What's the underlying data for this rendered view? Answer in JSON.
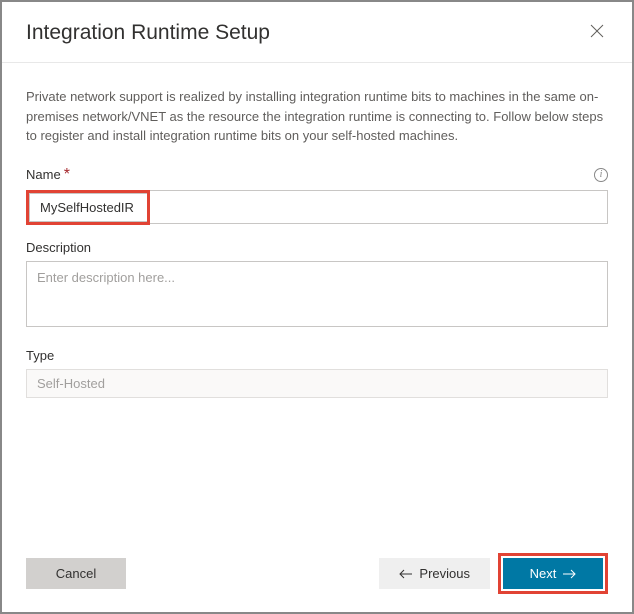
{
  "header": {
    "title": "Integration Runtime Setup"
  },
  "intro_text": "Private network support is realized by installing integration runtime bits to machines in the same on-premises network/VNET as the resource the integration runtime is connecting to. Follow below steps to register and install integration runtime bits on your self-hosted machines.",
  "fields": {
    "name": {
      "label": "Name",
      "value": "MySelfHostedIR"
    },
    "description": {
      "label": "Description",
      "placeholder": "Enter description here..."
    },
    "type": {
      "label": "Type",
      "value": "Self-Hosted"
    }
  },
  "buttons": {
    "cancel": "Cancel",
    "previous": "Previous",
    "next": "Next"
  }
}
